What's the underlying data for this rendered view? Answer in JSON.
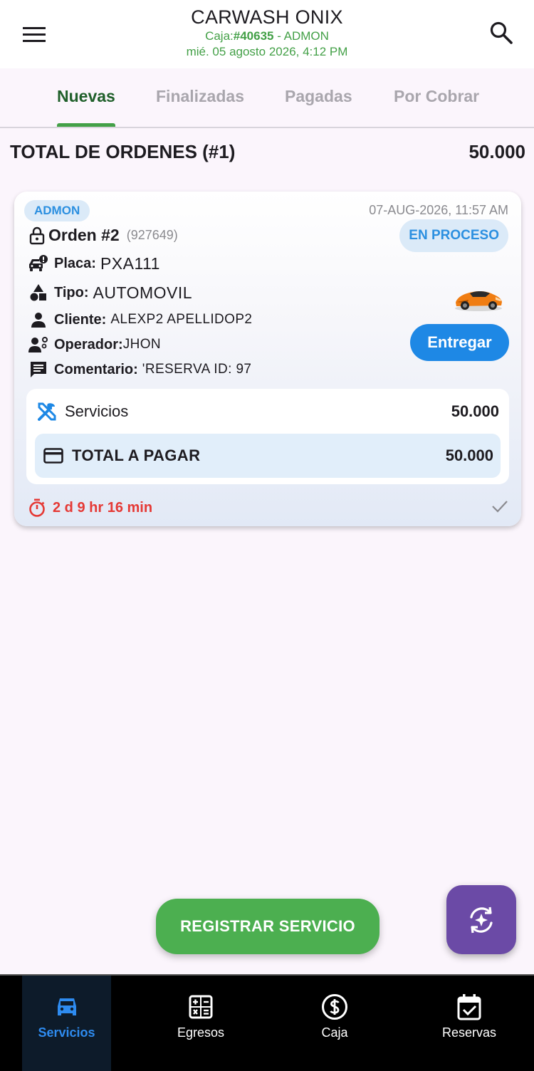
{
  "header": {
    "title": "CARWASH ONIX",
    "caja_prefix": "Caja:",
    "caja_number": "#40635",
    "caja_user": " - ADMON",
    "datetime": "mié. 05 agosto 2026, 4:12 PM"
  },
  "tabs": [
    {
      "label": "Nuevas",
      "active": true
    },
    {
      "label": "Finalizadas",
      "active": false
    },
    {
      "label": "Pagadas",
      "active": false
    },
    {
      "label": "Por Cobrar",
      "active": false
    }
  ],
  "summary": {
    "label": "TOTAL DE ORDENES (#1)",
    "value": "50.000"
  },
  "order": {
    "user_chip": "ADMON",
    "timestamp": "07-AUG-2026, 11:57 AM",
    "title": "Orden #2",
    "id": "(927649)",
    "status": "EN PROCESO",
    "plate_label": "Placa:",
    "plate": "PXA111",
    "type_label": "Tipo:",
    "type": "AUTOMOVIL",
    "client_label": "Cliente:",
    "client": "ALEXP2 APELLIDOP2",
    "operator_label": "Operador:",
    "operator": "JHON",
    "comment_label": "Comentario:",
    "comment": "'RESERVA ID: 97",
    "deliver_button": "Entregar",
    "services_label": "Servicios",
    "services_value": "50.000",
    "total_label": "TOTAL A PAGAR",
    "total_value": "50.000",
    "elapsed": "2 d 9 hr 16 min"
  },
  "actions": {
    "register_button": "REGISTRAR SERVICIO"
  },
  "bottom_nav": [
    {
      "label": "Servicios",
      "icon": "car-icon",
      "active": true
    },
    {
      "label": "Egresos",
      "icon": "calculator-icon",
      "active": false
    },
    {
      "label": "Caja",
      "icon": "dollar-icon",
      "active": false
    },
    {
      "label": "Reservas",
      "icon": "calendar-check-icon",
      "active": false
    }
  ],
  "colors": {
    "green": "#43a047",
    "blue": "#1e88e5",
    "red": "#e53935",
    "purple": "#6b4aa6"
  }
}
